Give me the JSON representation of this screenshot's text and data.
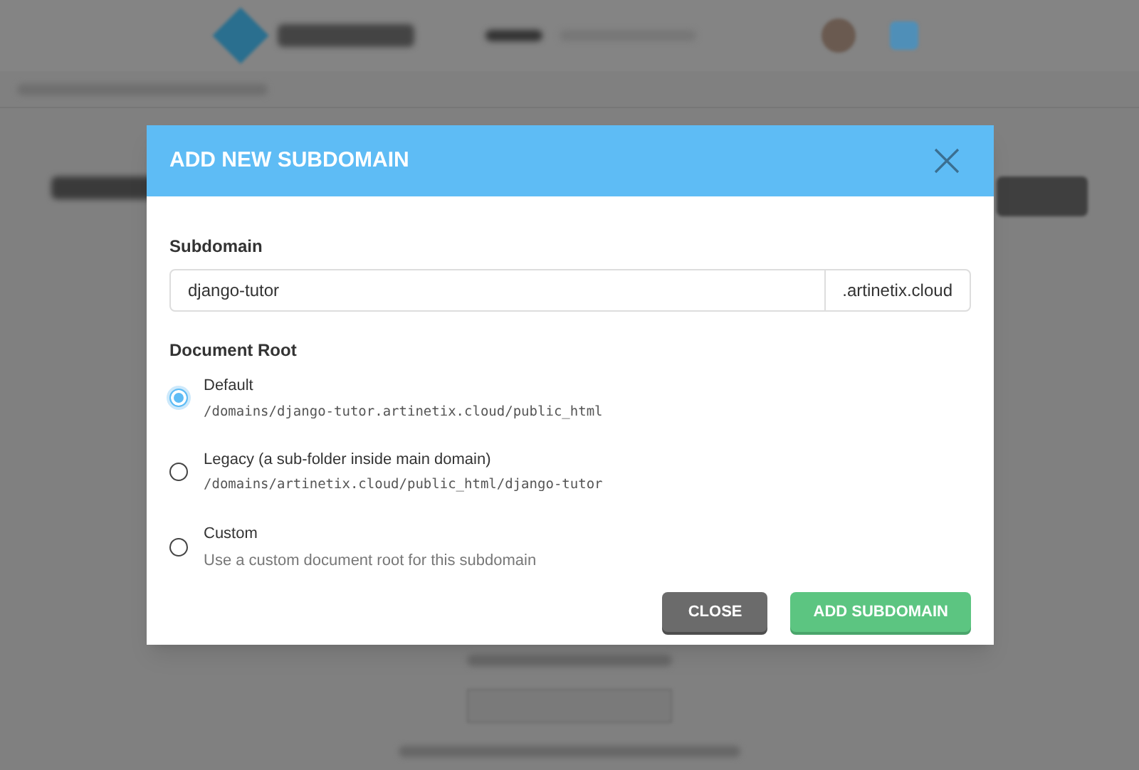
{
  "dialog": {
    "title": "ADD NEW SUBDOMAIN",
    "subdomain": {
      "label": "Subdomain",
      "value": "django-tutor",
      "suffix": ".artinetix.cloud"
    },
    "document_root": {
      "label": "Document Root",
      "options": [
        {
          "label": "Default",
          "detail": "/domains/django-tutor.artinetix.cloud/public_html",
          "kind": "path",
          "selected": true
        },
        {
          "label": "Legacy (a sub-folder inside main domain)",
          "detail": "/domains/artinetix.cloud/public_html/django-tutor",
          "kind": "path",
          "selected": false
        },
        {
          "label": "Custom",
          "detail": "Use a custom document root for this subdomain",
          "kind": "text",
          "selected": false
        }
      ]
    },
    "buttons": [
      {
        "label": "CLOSE",
        "kind": "secondary"
      },
      {
        "label": "ADD SUBDOMAIN",
        "kind": "primary"
      }
    ]
  }
}
